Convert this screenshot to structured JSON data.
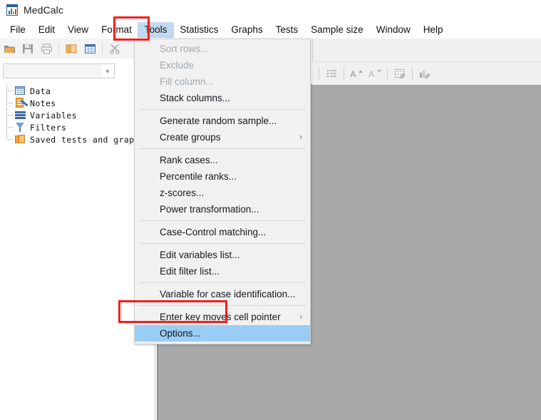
{
  "window": {
    "title": "MedCalc",
    "app_icon": "medcalc-chart-icon"
  },
  "menubar": {
    "items": [
      {
        "label": "File",
        "active": false
      },
      {
        "label": "Edit",
        "active": false
      },
      {
        "label": "View",
        "active": false
      },
      {
        "label": "Format",
        "active": false
      },
      {
        "label": "Tools",
        "active": true
      },
      {
        "label": "Statistics",
        "active": false
      },
      {
        "label": "Graphs",
        "active": false
      },
      {
        "label": "Tests",
        "active": false
      },
      {
        "label": "Sample size",
        "active": false
      },
      {
        "label": "Window",
        "active": false
      },
      {
        "label": "Help",
        "active": false
      }
    ]
  },
  "toolbar_left": {
    "buttons": [
      {
        "icon": "open-folder-icon"
      },
      {
        "icon": "save-disk-icon"
      },
      {
        "icon": "print-icon"
      },
      {
        "icon": "copy-icon"
      },
      {
        "icon": "spreadsheet-icon"
      },
      {
        "icon": "cut-scissors-icon"
      }
    ]
  },
  "toolbar_right": {
    "buttons": [
      {
        "icon": "bulleted-list-icon"
      },
      {
        "icon": "increase-decimals-icon"
      },
      {
        "icon": "decrease-decimals-icon"
      },
      {
        "icon": "edit-table-icon"
      },
      {
        "icon": "edit-chart-icon"
      }
    ]
  },
  "combo": {
    "value": "",
    "placeholder": "",
    "arrow_icon": "chevron-down-icon"
  },
  "tree": {
    "items": [
      {
        "label": "Data",
        "icon": "table-icon"
      },
      {
        "label": "Notes",
        "icon": "notepad-pen-icon"
      },
      {
        "label": "Variables",
        "icon": "layers-icon"
      },
      {
        "label": "Filters",
        "icon": "funnel-icon"
      },
      {
        "label": "Saved tests and graphs",
        "icon": "folders-icon"
      }
    ]
  },
  "tools_menu": {
    "groups": [
      [
        {
          "label": "Sort rows...",
          "disabled": true,
          "submenu": false,
          "selected": false
        },
        {
          "label": "Exclude",
          "disabled": true,
          "submenu": false,
          "selected": false
        },
        {
          "label": "Fill column...",
          "disabled": true,
          "submenu": false,
          "selected": false
        },
        {
          "label": "Stack columns...",
          "disabled": false,
          "submenu": false,
          "selected": false
        }
      ],
      [
        {
          "label": "Generate random sample...",
          "disabled": false,
          "submenu": false,
          "selected": false
        },
        {
          "label": "Create groups",
          "disabled": false,
          "submenu": true,
          "selected": false
        }
      ],
      [
        {
          "label": "Rank cases...",
          "disabled": false,
          "submenu": false,
          "selected": false
        },
        {
          "label": "Percentile ranks...",
          "disabled": false,
          "submenu": false,
          "selected": false
        },
        {
          "label": "z-scores...",
          "disabled": false,
          "submenu": false,
          "selected": false
        },
        {
          "label": "Power transformation...",
          "disabled": false,
          "submenu": false,
          "selected": false
        }
      ],
      [
        {
          "label": "Case-Control matching...",
          "disabled": false,
          "submenu": false,
          "selected": false
        }
      ],
      [
        {
          "label": "Edit variables list...",
          "disabled": false,
          "submenu": false,
          "selected": false
        },
        {
          "label": "Edit filter list...",
          "disabled": false,
          "submenu": false,
          "selected": false
        }
      ],
      [
        {
          "label": "Variable for case identification...",
          "disabled": false,
          "submenu": false,
          "selected": false
        }
      ],
      [
        {
          "label": "Enter key moves cell pointer",
          "disabled": false,
          "submenu": true,
          "selected": false
        },
        {
          "label": "Options...",
          "disabled": false,
          "submenu": false,
          "selected": true
        }
      ]
    ],
    "submenu_arrow": "›"
  },
  "annotations": [
    {
      "name": "tools-menu-highlight",
      "color": "#f51e1e"
    },
    {
      "name": "options-item-highlight",
      "color": "#f51e1e"
    }
  ],
  "colors": {
    "selection_blue": "#9acdf5",
    "menu_bg": "#f1f1f1",
    "workspace_gray": "#a9a9a9",
    "annotation_red": "#f51e1e"
  }
}
